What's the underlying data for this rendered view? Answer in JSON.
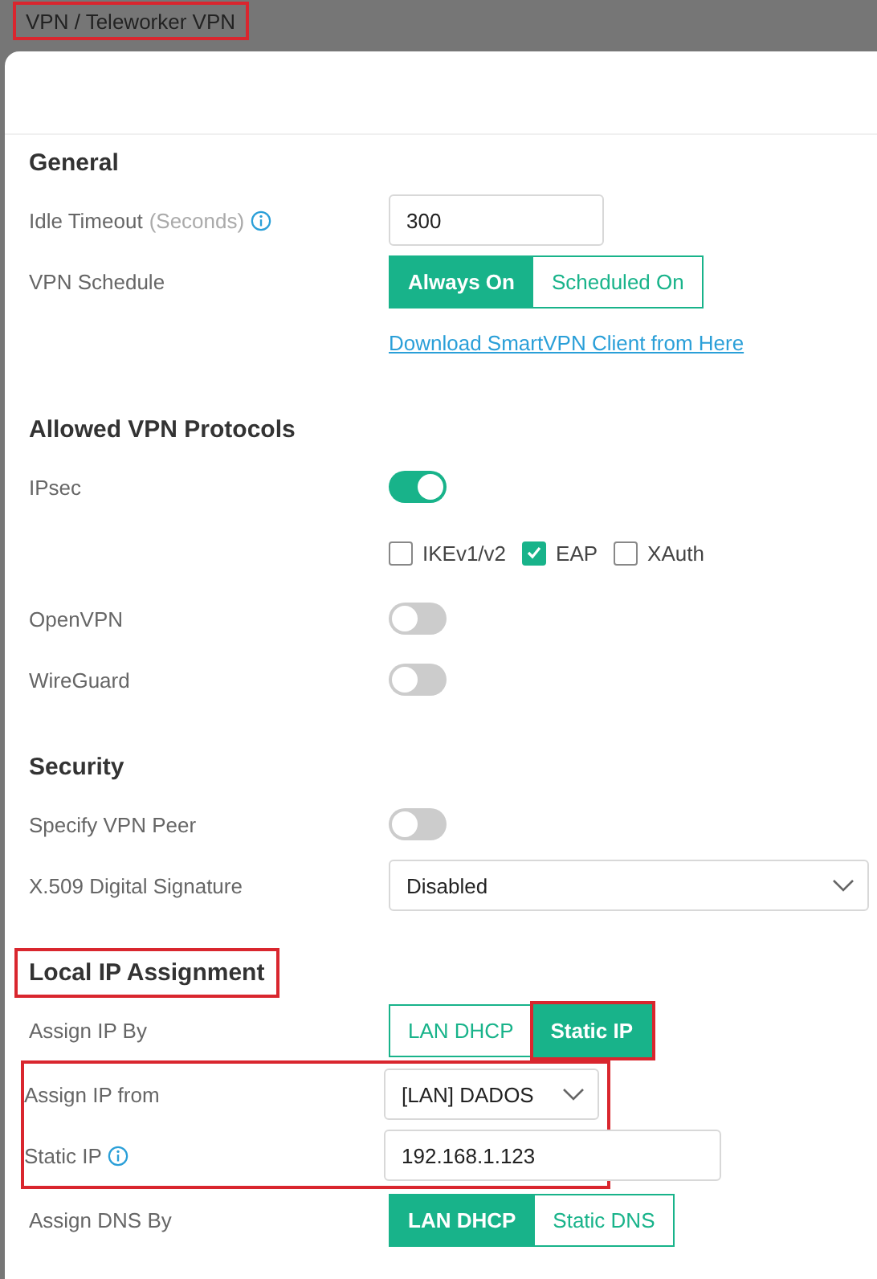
{
  "title": {
    "text": "VPN / Teleworker VPN",
    "highlighted": true
  },
  "sections": [
    {
      "heading": "General",
      "highlighted": false,
      "rows": [
        {
          "kind": "input",
          "label": "Idle Timeout",
          "hint": "(Seconds)",
          "info": true,
          "value": "300"
        },
        {
          "kind": "segmented",
          "label": "VPN Schedule",
          "options": [
            {
              "label": "Always On",
              "selected": true,
              "highlighted": false
            },
            {
              "label": "Scheduled On",
              "selected": false,
              "highlighted": false
            }
          ]
        },
        {
          "kind": "link",
          "text": "Download SmartVPN Client from Here"
        }
      ]
    },
    {
      "heading": "Allowed VPN Protocols",
      "highlighted": false,
      "rows": [
        {
          "kind": "toggle",
          "label": "IPsec",
          "on": true
        },
        {
          "kind": "checkboxes",
          "items": [
            {
              "label": "IKEv1/v2",
              "checked": false
            },
            {
              "label": "EAP",
              "checked": true
            },
            {
              "label": "XAuth",
              "checked": false
            }
          ]
        },
        {
          "kind": "toggle",
          "label": "OpenVPN",
          "on": false
        },
        {
          "kind": "toggle",
          "label": "WireGuard",
          "on": false
        }
      ]
    },
    {
      "heading": "Security",
      "highlighted": false,
      "rows": [
        {
          "kind": "toggle",
          "label": "Specify VPN Peer",
          "on": false
        },
        {
          "kind": "select",
          "label": "X.509 Digital Signature",
          "value": "Disabled"
        }
      ]
    },
    {
      "heading": "Local IP Assignment",
      "highlighted": true,
      "rows": [
        {
          "kind": "segmented",
          "label": "Assign IP By",
          "options": [
            {
              "label": "LAN DHCP",
              "selected": false,
              "highlighted": false
            },
            {
              "label": "Static IP",
              "selected": true,
              "highlighted": true
            }
          ]
        },
        {
          "kind": "group",
          "highlighted": true,
          "rows": [
            {
              "kind": "select",
              "label": "Assign IP from",
              "value": "[LAN] DADOS"
            },
            {
              "kind": "input",
              "label": "Static IP",
              "info": true,
              "value": "192.168.1.123"
            }
          ]
        },
        {
          "kind": "segmented",
          "label": "Assign DNS By",
          "options": [
            {
              "label": "LAN DHCP",
              "selected": true,
              "highlighted": false
            },
            {
              "label": "Static DNS",
              "selected": false,
              "highlighted": false
            }
          ]
        }
      ]
    }
  ]
}
